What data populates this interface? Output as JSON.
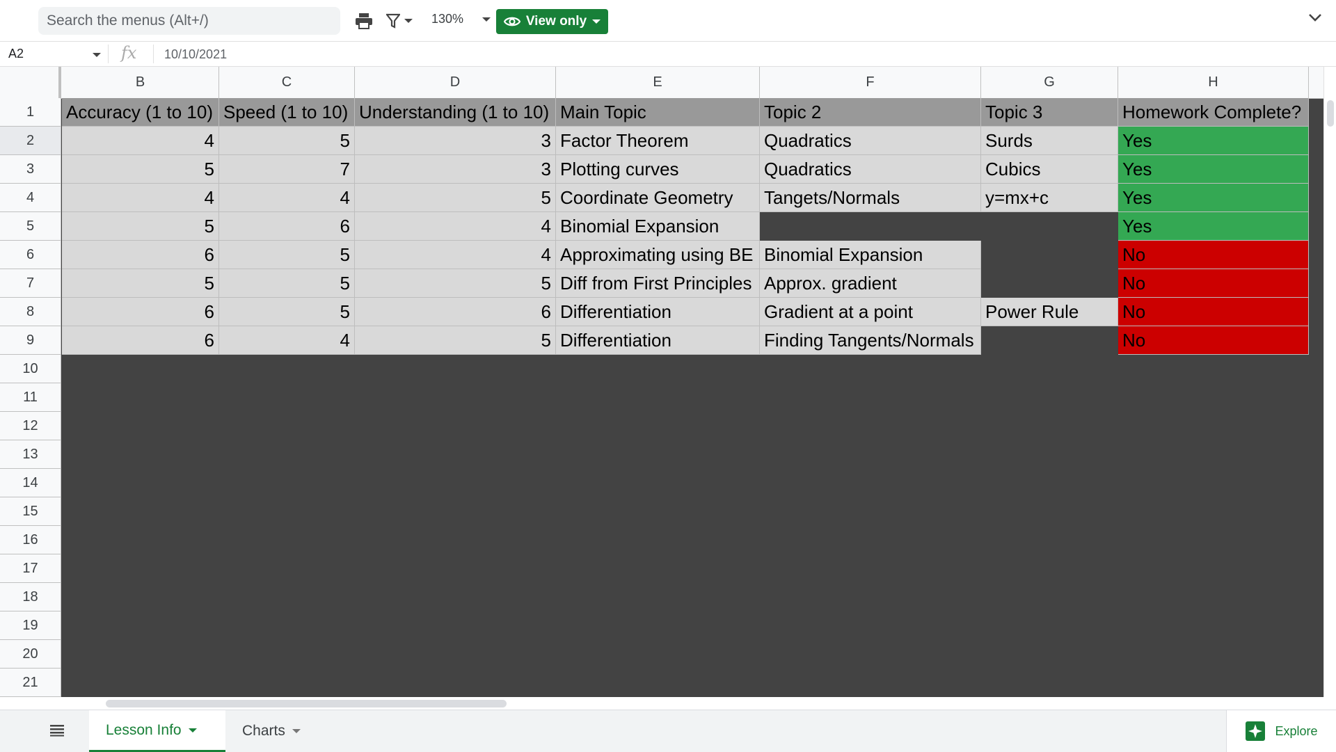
{
  "toolbar": {
    "search_placeholder": "Search the menus (Alt+/)",
    "zoom": "130%",
    "view_mode": "View only"
  },
  "formula_bar": {
    "cell_ref": "A2",
    "fx": "fx",
    "value": "10/10/2021"
  },
  "columns": [
    "B",
    "C",
    "D",
    "E",
    "F",
    "G",
    "H"
  ],
  "rows": [
    "1",
    "2",
    "3",
    "4",
    "5",
    "6",
    "7",
    "8",
    "9",
    "10",
    "11",
    "12",
    "13",
    "14",
    "15",
    "16",
    "17",
    "18",
    "19",
    "20",
    "21"
  ],
  "table": {
    "headers": [
      "Accuracy (1 to 10)",
      "Speed (1 to 10)",
      "Understanding (1 to 10)",
      "Main Topic",
      "Topic 2",
      "Topic 3",
      "Homework Complete?"
    ],
    "rows": [
      [
        "4",
        "5",
        "3",
        "Factor Theorem",
        "Quadratics",
        "Surds",
        "Yes"
      ],
      [
        "5",
        "7",
        "3",
        "Plotting curves",
        "Quadratics",
        "Cubics",
        "Yes"
      ],
      [
        "4",
        "4",
        "5",
        "Coordinate Geometry",
        "Tangets/Normals",
        "y=mx+c",
        "Yes"
      ],
      [
        "5",
        "6",
        "4",
        "Binomial Expansion",
        "",
        "",
        "Yes"
      ],
      [
        "6",
        "5",
        "4",
        "Approximating using BE",
        "Binomial Expansion",
        "",
        "No"
      ],
      [
        "5",
        "5",
        "5",
        "Diff from First Principles",
        "Approx. gradient",
        "",
        "No"
      ],
      [
        "6",
        "5",
        "6",
        "Differentiation",
        "Gradient at a point",
        "Power Rule",
        "No"
      ],
      [
        "6",
        "4",
        "5",
        "Differentiation",
        "Finding Tangents/Normals",
        "",
        "No"
      ]
    ]
  },
  "colors": {
    "yes": "#34a853",
    "no": "#cc0000",
    "header_fill": "#999999",
    "cell_fill": "#d9d9d9",
    "background": "#434343",
    "accent": "#188038"
  },
  "sheets": {
    "tabs": [
      "Lesson Info",
      "Charts"
    ],
    "active": "Lesson Info"
  },
  "explore_label": "Explore"
}
